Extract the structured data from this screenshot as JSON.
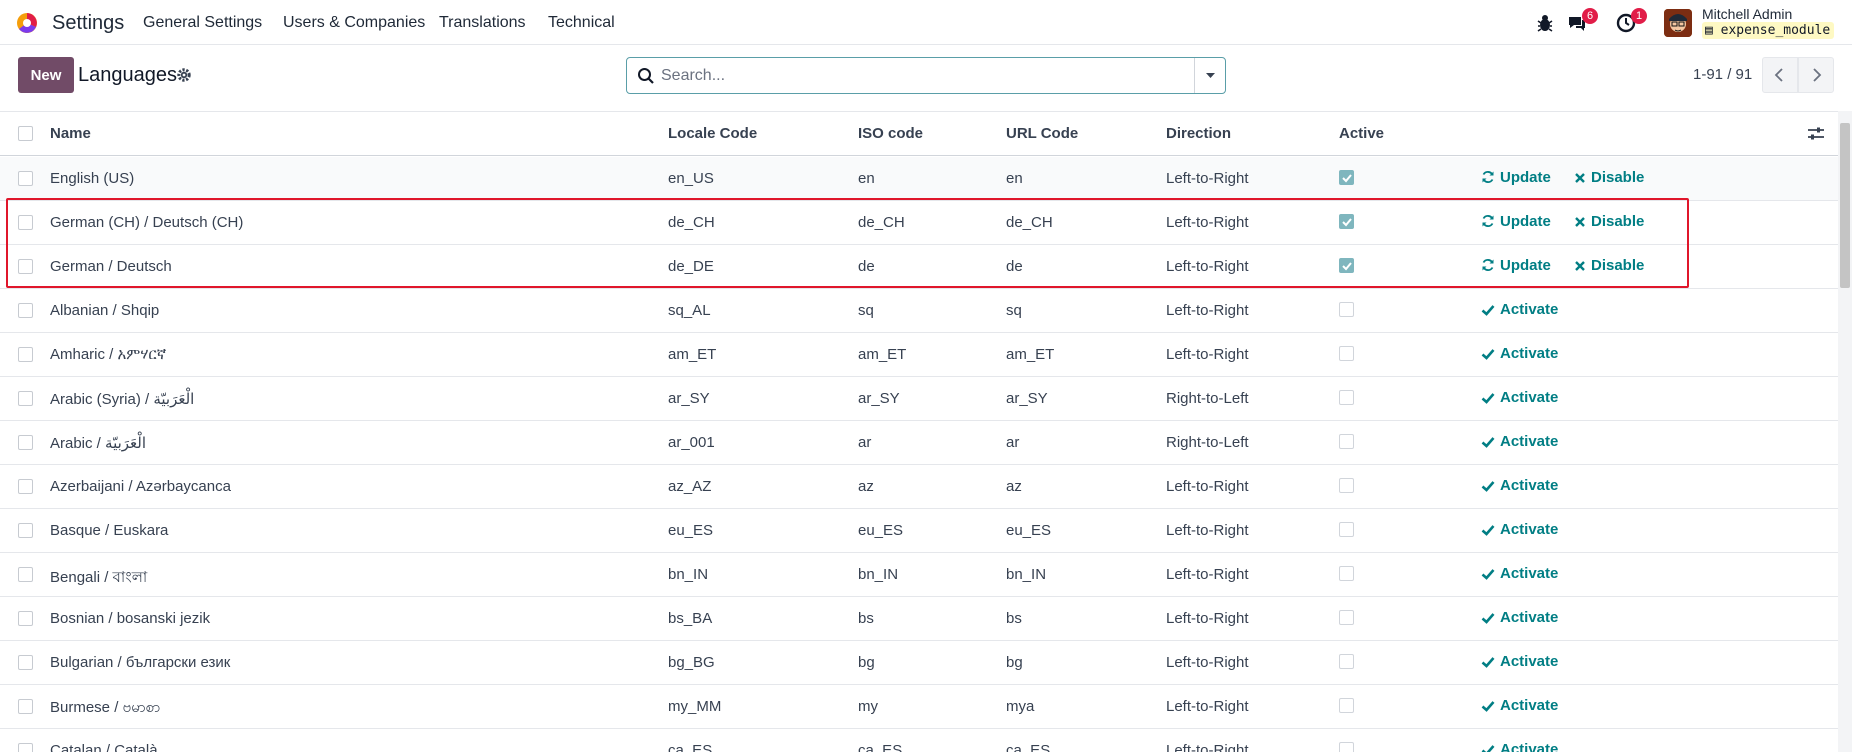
{
  "navbar": {
    "app_name": "Settings",
    "menu": [
      "General Settings",
      "Users & Companies",
      "Translations",
      "Technical"
    ],
    "messages_count": "6",
    "activities_count": "1",
    "user_name": "Mitchell Admin",
    "database": "expense_module"
  },
  "control_panel": {
    "new_label": "New",
    "title": "Languages",
    "search_placeholder": "Search...",
    "pager": "1-91 / 91"
  },
  "table": {
    "headers": [
      "Name",
      "Locale Code",
      "ISO code",
      "URL Code",
      "Direction",
      "Active"
    ],
    "rows": [
      {
        "name": "English (US)",
        "locale": "en_US",
        "iso": "en",
        "url": "en",
        "direction": "Left-to-Right",
        "active": true
      },
      {
        "name": "German (CH) / Deutsch (CH)",
        "locale": "de_CH",
        "iso": "de_CH",
        "url": "de_CH",
        "direction": "Left-to-Right",
        "active": true
      },
      {
        "name": "German / Deutsch",
        "locale": "de_DE",
        "iso": "de",
        "url": "de",
        "direction": "Left-to-Right",
        "active": true
      },
      {
        "name": "Albanian / Shqip",
        "locale": "sq_AL",
        "iso": "sq",
        "url": "sq",
        "direction": "Left-to-Right",
        "active": false
      },
      {
        "name": "Amharic / አምሃርኛ",
        "locale": "am_ET",
        "iso": "am_ET",
        "url": "am_ET",
        "direction": "Left-to-Right",
        "active": false
      },
      {
        "name": "Arabic (Syria) / الْعَرَبيّة",
        "locale": "ar_SY",
        "iso": "ar_SY",
        "url": "ar_SY",
        "direction": "Right-to-Left",
        "active": false
      },
      {
        "name": "Arabic / الْعَرَبيّة",
        "locale": "ar_001",
        "iso": "ar",
        "url": "ar",
        "direction": "Right-to-Left",
        "active": false
      },
      {
        "name": "Azerbaijani / Azərbaycanca",
        "locale": "az_AZ",
        "iso": "az",
        "url": "az",
        "direction": "Left-to-Right",
        "active": false
      },
      {
        "name": "Basque / Euskara",
        "locale": "eu_ES",
        "iso": "eu_ES",
        "url": "eu_ES",
        "direction": "Left-to-Right",
        "active": false
      },
      {
        "name": "Bengali / বাংলা",
        "locale": "bn_IN",
        "iso": "bn_IN",
        "url": "bn_IN",
        "direction": "Left-to-Right",
        "active": false
      },
      {
        "name": "Bosnian / bosanski jezik",
        "locale": "bs_BA",
        "iso": "bs",
        "url": "bs",
        "direction": "Left-to-Right",
        "active": false
      },
      {
        "name": "Bulgarian / български език",
        "locale": "bg_BG",
        "iso": "bg",
        "url": "bg",
        "direction": "Left-to-Right",
        "active": false
      },
      {
        "name": "Burmese / ဗမာစာ",
        "locale": "my_MM",
        "iso": "my",
        "url": "mya",
        "direction": "Left-to-Right",
        "active": false
      },
      {
        "name": "Catalan / Català",
        "locale": "ca_ES",
        "iso": "ca_ES",
        "url": "ca_ES",
        "direction": "Left-to-Right",
        "active": false
      }
    ],
    "actions": {
      "update": "Update",
      "disable": "Disable",
      "activate": "Activate"
    }
  },
  "colors": {
    "brand": "#714b67",
    "action": "#017e84",
    "highlight": "#e0162b",
    "badge": "#e11d48"
  }
}
